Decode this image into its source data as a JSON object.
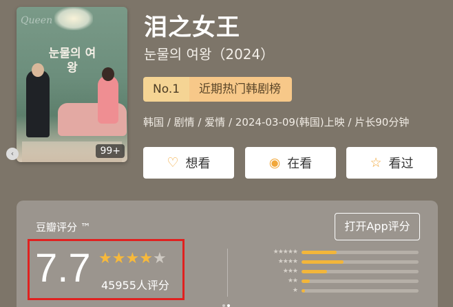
{
  "poster": {
    "text": "눈물의 여왕",
    "badge": "99+",
    "watermark": "Queen"
  },
  "title": "泪之女王",
  "subtitle": "눈물의 여왕（2024）",
  "ranking": {
    "no": "No.1",
    "label": "近期热门韩剧榜"
  },
  "meta": "韩国 / 剧情 / 爱情 / 2024-03-09(韩国)上映 / 片长90分钟",
  "actions": [
    {
      "label": "想看",
      "icon": "heart-plus-icon"
    },
    {
      "label": "在看",
      "icon": "target-icon"
    },
    {
      "label": "看过",
      "icon": "star-outline-icon"
    }
  ],
  "rating": {
    "source": "豆瓣评分 ™",
    "open_app": "打开App评分",
    "score": "7.7",
    "stars": 4,
    "count": "45955人评分",
    "distribution": [
      0.3,
      0.36,
      0.22,
      0.07,
      0.03
    ]
  },
  "colors": {
    "accent": "#f3b63a",
    "highlight_box": "#e0211f",
    "background": "#7d7569"
  }
}
